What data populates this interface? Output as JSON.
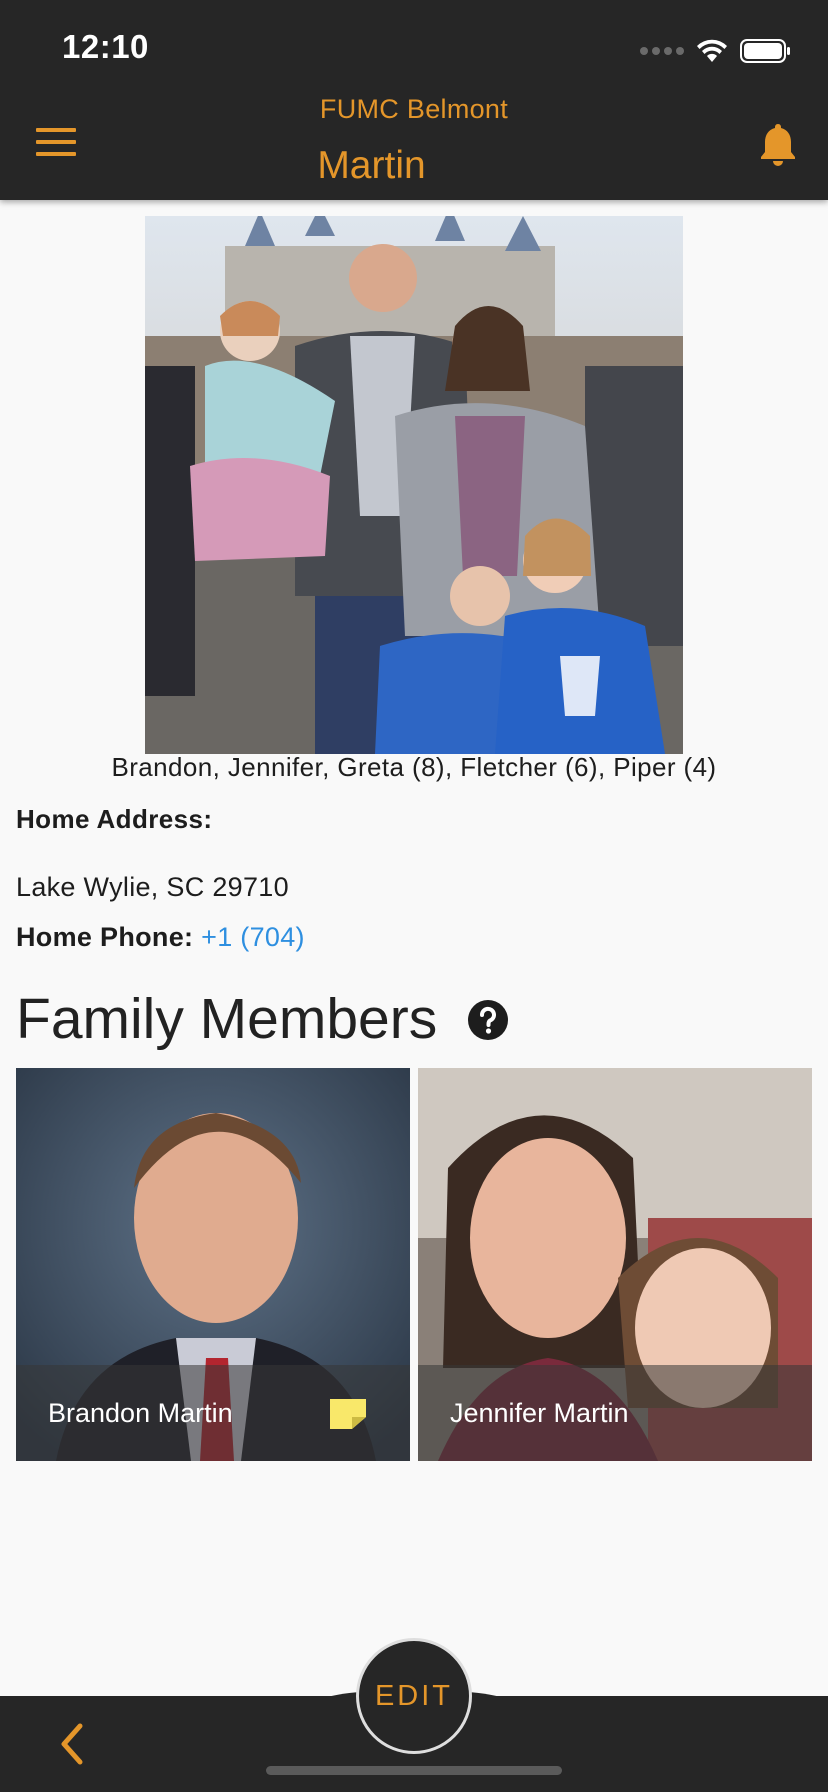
{
  "status_bar": {
    "time": "12:10"
  },
  "header": {
    "org_name": "FUMC Belmont",
    "title": "Martin"
  },
  "family": {
    "caption": "Brandon, Jennifer, Greta (8), Fletcher (6), Piper (4)",
    "home_address_label": "Home Address:",
    "home_address_value": "Lake Wylie, SC 29710",
    "home_phone_label": "Home Phone:",
    "home_phone_value": "+1 (704)"
  },
  "members_section": {
    "title": "Family Members",
    "members": [
      {
        "name": "Brandon Martin"
      },
      {
        "name": "Jennifer Martin"
      }
    ]
  },
  "bottom": {
    "edit_label": "EDIT"
  },
  "colors": {
    "accent": "#e4962a",
    "bar": "#262626",
    "link": "#2e8fe0",
    "note": "#f9e86a"
  },
  "icons": [
    "menu-icon",
    "bell-icon",
    "help-icon",
    "note-icon",
    "back-chevron-icon",
    "wifi-icon",
    "battery-icon"
  ]
}
